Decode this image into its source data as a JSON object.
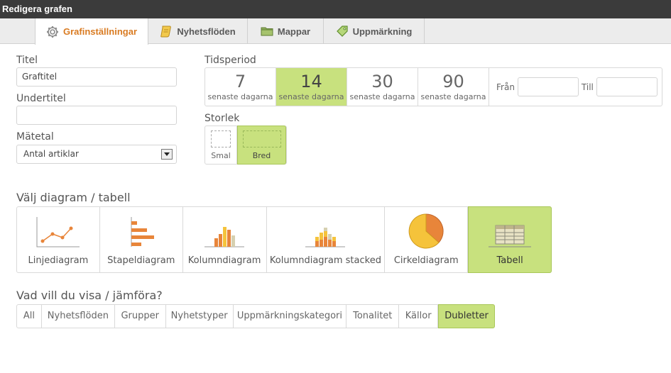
{
  "window": {
    "title": "Redigera grafen"
  },
  "tabs": [
    {
      "label": "Grafinställningar",
      "icon": "gear-icon",
      "active": true
    },
    {
      "label": "Nyhetsflöden",
      "icon": "scroll-icon",
      "active": false
    },
    {
      "label": "Mappar",
      "icon": "folder-icon",
      "active": false
    },
    {
      "label": "Uppmärkning",
      "icon": "tag-icon",
      "active": false
    }
  ],
  "form": {
    "title_label": "Titel",
    "title_value": "Graftitel",
    "subtitle_label": "Undertitel",
    "subtitle_value": "",
    "metric_label": "Mätetal",
    "metric_value": "Antal artiklar"
  },
  "period": {
    "label": "Tidsperiod",
    "options": [
      {
        "number": "7",
        "sub": "senaste dagarna",
        "active": false
      },
      {
        "number": "14",
        "sub": "senaste dagarna",
        "active": true
      },
      {
        "number": "30",
        "sub": "senaste dagarna",
        "active": false
      },
      {
        "number": "90",
        "sub": "senaste dagarna",
        "active": false
      }
    ],
    "from_label": "Från",
    "to_label": "Till"
  },
  "size": {
    "label": "Storlek",
    "small_label": "Smal",
    "wide_label": "Bred",
    "selected": "wide"
  },
  "chart_select": {
    "title": "Välj diagram / tabell",
    "options": [
      {
        "label": "Linjediagram",
        "icon": "line-chart-icon",
        "active": false
      },
      {
        "label": "Stapeldiagram",
        "icon": "bar-chart-icon",
        "active": false
      },
      {
        "label": "Kolumndiagram",
        "icon": "column-chart-icon",
        "active": false
      },
      {
        "label": "Kolumndiagram stacked",
        "icon": "stacked-column-chart-icon",
        "active": false
      },
      {
        "label": "Cirkeldiagram",
        "icon": "pie-chart-icon",
        "active": false
      },
      {
        "label": "Tabell",
        "icon": "table-icon",
        "active": true
      }
    ]
  },
  "compare": {
    "title": "Vad vill du visa / jämföra?",
    "options": [
      {
        "label": "All",
        "active": false
      },
      {
        "label": "Nyhetsflöden",
        "active": false
      },
      {
        "label": "Grupper",
        "active": false
      },
      {
        "label": "Nyhetstyper",
        "active": false
      },
      {
        "label": "Uppmärkningskategori",
        "active": false
      },
      {
        "label": "Tonalitet",
        "active": false
      },
      {
        "label": "Källor",
        "active": false
      },
      {
        "label": "Dubletter",
        "active": true
      }
    ]
  },
  "colors": {
    "accent_green": "#c8e17e",
    "active_tab_text": "#d97b22",
    "icon_orange": "#e8853a",
    "icon_yellow": "#f5c33b"
  }
}
